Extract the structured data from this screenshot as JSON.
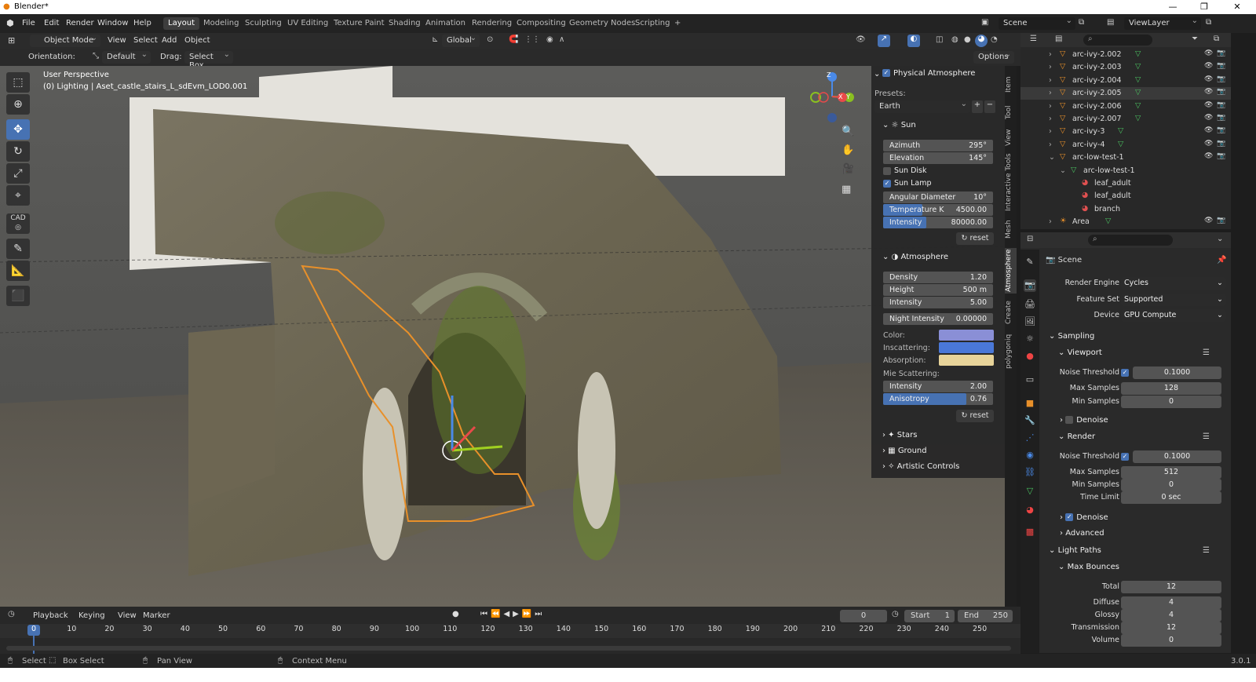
{
  "title": "Blender*",
  "menus": [
    "File",
    "Edit",
    "Render",
    "Window",
    "Help"
  ],
  "workspaces": [
    "Layout",
    "Modeling",
    "Sculpting",
    "UV Editing",
    "Texture Paint",
    "Shading",
    "Animation",
    "Rendering",
    "Compositing",
    "Geometry Nodes",
    "Scripting",
    "+"
  ],
  "scene": "Scene",
  "viewlayer": "ViewLayer",
  "header2": {
    "mode": "Object Mode",
    "items": [
      "View",
      "Select",
      "Add",
      "Object"
    ],
    "transform": "Global"
  },
  "header3": {
    "orientation_label": "Orientation:",
    "orientation": "Default",
    "drag_label": "Drag:",
    "drag": "Select Box",
    "options": "Options"
  },
  "viewport": {
    "line1": "User Perspective",
    "line2": "(0) Lighting | Aset_castle_stairs_L_sdEvm_LOD0.001"
  },
  "gizmo": {
    "x": "X",
    "y": "Y",
    "z": "Z"
  },
  "npanel": {
    "title": "Physical Atmosphere",
    "presets_label": "Presets:",
    "preset": "Earth",
    "sun_title": "Sun",
    "azimuth_k": "Azimuth",
    "azimuth_v": "295°",
    "elevation_k": "Elevation",
    "elevation_v": "145°",
    "sun_disk": "Sun Disk",
    "sun_lamp": "Sun Lamp",
    "ang_k": "Angular Diameter",
    "ang_v": "10°",
    "temp_k": "Temperature K",
    "temp_v": "4500.00",
    "int_k": "Intensity",
    "int_v": "80000.00",
    "reset": "reset",
    "atmo_title": "Atmosphere",
    "density_k": "Density",
    "density_v": "1.20",
    "height_k": "Height",
    "height_v": "500 m",
    "aint_k": "Intensity",
    "aint_v": "5.00",
    "night_k": "Night Intensity",
    "night_v": "0.00000",
    "color_k": "Color:",
    "inscat_k": "Inscattering:",
    "absorp_k": "Absorption:",
    "color_c": "#8a8fd6",
    "inscat_c": "#4a78d8",
    "absorp_c": "#e8d49a",
    "mie_k": "Mie Scattering:",
    "mint_k": "Intensity",
    "mint_v": "2.00",
    "aniso_k": "Anisotropy",
    "aniso_v": "0.76",
    "reset2": "reset",
    "stars": "Stars",
    "ground": "Ground",
    "artistic": "Artistic Controls"
  },
  "vtabs": [
    "Item",
    "Tool",
    "View",
    "Interactive Tools",
    "Mesh",
    "Atmosphere",
    "Create",
    "polygoniq"
  ],
  "outliner": [
    {
      "name": "arc-ivy-2.002",
      "indent": 0
    },
    {
      "name": "arc-ivy-2.003",
      "indent": 0
    },
    {
      "name": "arc-ivy-2.004",
      "indent": 0
    },
    {
      "name": "arc-ivy-2.005",
      "indent": 0
    },
    {
      "name": "arc-ivy-2.006",
      "indent": 0
    },
    {
      "name": "arc-ivy-2.007",
      "indent": 0
    },
    {
      "name": "arc-ivy-3",
      "indent": 0
    },
    {
      "name": "arc-ivy-4",
      "indent": 0
    },
    {
      "name": "arc-low-test-1",
      "indent": 0
    },
    {
      "name": "arc-low-test-1",
      "indent": 1
    },
    {
      "name": "leaf_adult",
      "indent": 2
    },
    {
      "name": "leaf_adult",
      "indent": 2
    },
    {
      "name": "branch",
      "indent": 2
    },
    {
      "name": "Area",
      "indent": 0
    }
  ],
  "props": {
    "scene": "Scene",
    "engine_k": "Render Engine",
    "engine_v": "Cycles",
    "feat_k": "Feature Set",
    "feat_v": "Supported",
    "device_k": "Device",
    "device_v": "GPU Compute",
    "sampling": "Sampling",
    "viewport": "Viewport",
    "vp_noise_k": "Noise Threshold",
    "vp_noise_v": "0.1000",
    "vp_max_k": "Max Samples",
    "vp_max_v": "128",
    "vp_min_k": "Min Samples",
    "vp_min_v": "0",
    "denoise1": "Denoise",
    "render": "Render",
    "r_noise_k": "Noise Threshold",
    "r_noise_v": "0.1000",
    "r_max_k": "Max Samples",
    "r_max_v": "512",
    "r_min_k": "Min Samples",
    "r_min_v": "0",
    "r_time_k": "Time Limit",
    "r_time_v": "0 sec",
    "denoise2": "Denoise",
    "advanced": "Advanced",
    "lightpaths": "Light Paths",
    "maxb": "Max Bounces",
    "total_k": "Total",
    "total_v": "12",
    "diffuse_k": "Diffuse",
    "diffuse_v": "4",
    "glossy_k": "Glossy",
    "glossy_v": "4",
    "trans_k": "Transmission",
    "trans_v": "12",
    "volume_k": "Volume",
    "volume_v": "0"
  },
  "timeline": {
    "menus": [
      "Playback",
      "Keying",
      "View",
      "Marker"
    ],
    "frame": "0",
    "start_k": "Start",
    "start_v": "1",
    "end_k": "End",
    "end_v": "250",
    "ticks": [
      "0",
      "10",
      "20",
      "30",
      "40",
      "50",
      "60",
      "70",
      "80",
      "90",
      "100",
      "110",
      "120",
      "130",
      "140",
      "150",
      "160",
      "170",
      "180",
      "190",
      "200",
      "210",
      "220",
      "230",
      "240",
      "250"
    ]
  },
  "status": {
    "select": "Select",
    "box": "Box Select",
    "pan": "Pan View",
    "ctx": "Context Menu",
    "version": "3.0.1"
  }
}
